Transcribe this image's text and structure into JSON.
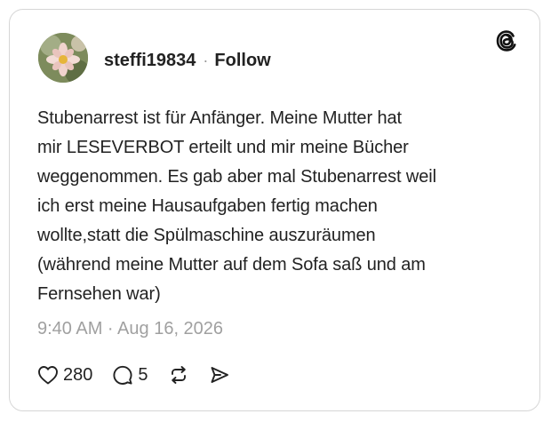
{
  "post": {
    "username": "steffi19834",
    "separator": "·",
    "follow_label": "Follow",
    "text": "Stubenarrest ist für Anfänger.  Meine Mutter hat\nmir LESEVERBOT  erteilt und mir meine Bücher\nweggenommen. Es gab aber mal Stubenarrest weil\nich erst meine Hausaufgaben  fertig machen\nwollte,statt die Spülmaschine auszuräumen\n(während meine Mutter auf dem Sofa saß und am\nFernsehen war)",
    "timestamp": "9:40 AM · Aug 16, 2026"
  },
  "actions": {
    "like_count": "280",
    "reply_count": "5"
  },
  "icons": {
    "brand": "threads-logo-icon",
    "like": "heart-icon",
    "reply": "comment-bubble-icon",
    "repost": "repost-icon",
    "share": "send-icon"
  },
  "colors": {
    "text": "#222222",
    "muted": "#a0a0a0",
    "border": "#d6d6d6"
  }
}
